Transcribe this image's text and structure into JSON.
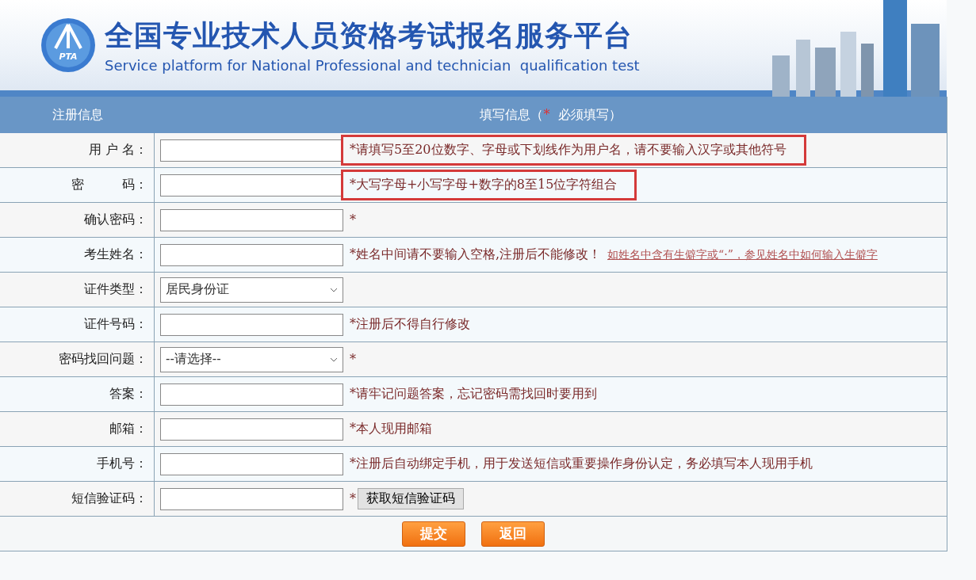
{
  "banner": {
    "logo_text": "PTA",
    "title": "全国专业技术人员资格考试报名服务平台",
    "subtitle": "Service platform for National Professional and technician  qualification test"
  },
  "table_header": {
    "column_1": "注册信息",
    "column_2_before": "填写信息（",
    "required_mark": "*",
    "column_2_after": "  必须填写）"
  },
  "rows": [
    {
      "kind": "text",
      "label": "用 户 名：",
      "hint": "*请填写5至20位数字、字母或下划线作为用户名，请不要输入汉字或其他符号",
      "highlighted": true
    },
    {
      "kind": "text",
      "label": "密　　　码：",
      "hint": "*大写字母+小写字母+数字的8至15位字符组合",
      "highlighted": true
    },
    {
      "kind": "text",
      "label": "确认密码：",
      "hint": "*"
    },
    {
      "kind": "text",
      "label": "考生姓名：",
      "hint": "*姓名中间请不要输入空格,注册后不能修改！",
      "link": "如姓名中含有生僻字或“·”，参见姓名中如何输入生僻字"
    },
    {
      "kind": "select",
      "label": "证件类型：",
      "value": "居民身份证"
    },
    {
      "kind": "text",
      "label": "证件号码：",
      "hint": "*注册后不得自行修改"
    },
    {
      "kind": "select",
      "label": "密码找回问题：",
      "value": "--请选择--",
      "hint": "*"
    },
    {
      "kind": "text",
      "label": "答案：",
      "hint": "*请牢记问题答案，忘记密码需找回时要用到"
    },
    {
      "kind": "text",
      "label": "邮箱：",
      "hint": "*本人现用邮箱"
    },
    {
      "kind": "text",
      "label": "手机号：",
      "hint": "*注册后自动绑定手机，用于发送短信或重要操作身份认定，务必填写本人现用手机"
    },
    {
      "kind": "sms",
      "label": "短信验证码：",
      "hint": "*",
      "button": "获取短信验证码"
    }
  ],
  "buttons": [
    "提交",
    "返回"
  ]
}
